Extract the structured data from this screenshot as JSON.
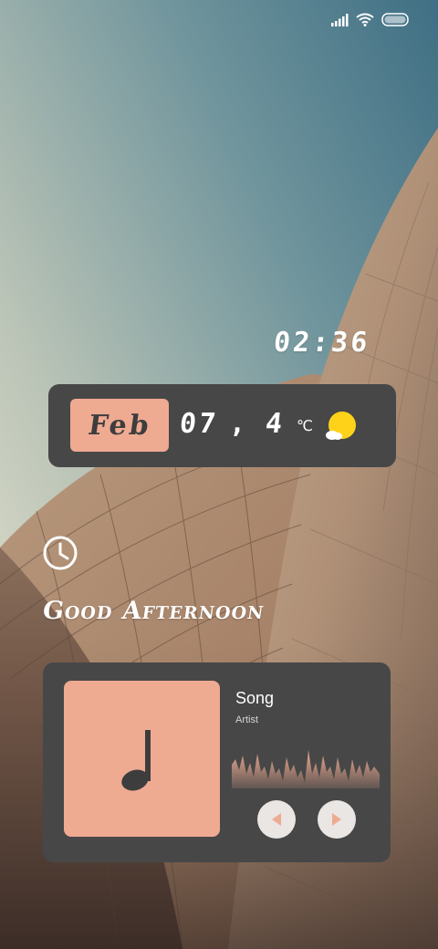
{
  "status_bar": {
    "icons": [
      "signal-icon",
      "wifi-icon",
      "battery-icon"
    ]
  },
  "clock": {
    "time": "02:36"
  },
  "date_widget": {
    "month": "Feb",
    "day": "07",
    "separator": ",",
    "temperature": "4",
    "unit": "℃",
    "weather_icon": "partly-sunny-icon"
  },
  "alarm": {
    "icon": "clock-icon"
  },
  "greeting": {
    "text": "Good Afternoon"
  },
  "music": {
    "title": "Song",
    "artist": "Artist",
    "art_icon": "music-note-icon",
    "controls": [
      "previous-icon",
      "next-icon"
    ]
  },
  "colors": {
    "accent": "#efaa92",
    "widget_bg": "#474747",
    "sun": "#ffd21a",
    "button_bg": "#e9e6e4"
  }
}
